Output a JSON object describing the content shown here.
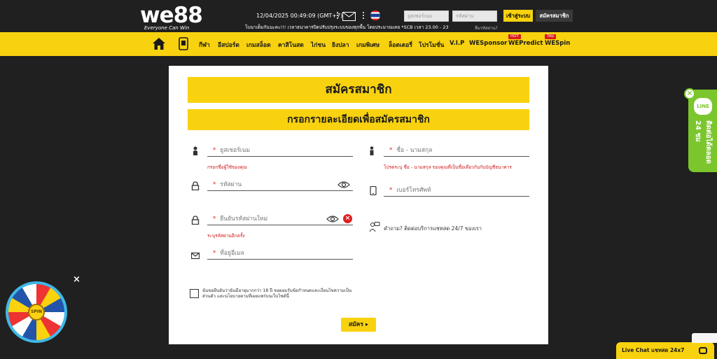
{
  "header": {
    "logo_text": "we88",
    "logo_tagline": "Everyone Can Win",
    "datetime": "12/04/2025 00:49:09",
    "timezone": "(GMT+7)",
    "username_placeholder": "ยูสเซอร์เนม",
    "password_placeholder": "รหัสผ่าน",
    "login_label": "เข้าสู่ระบบ",
    "register_label": "สมัครสมาชิก",
    "ticker_text": "โบนาเต็มกันนะคะ!!!    เวลาธนาคารปิดปรับปรุงระบบของทุกพื้น โดยประมาณเคย *SCB เวลา 23.00 - 23.3",
    "forgot_password": "ลืมรหัสผ่าน?"
  },
  "nav": {
    "items": [
      "กีฬา",
      "อีสปอร์ต",
      "เกมสล็อต",
      "คาสิโนสด",
      "ไก่ชน",
      "ยิงปลา",
      "เกมพิเศษ",
      "ล็อตเตอรี่",
      "โปรโมชั่น",
      "V.I.P",
      "WESponsor",
      "WEPredict",
      "WESpin"
    ],
    "badge_hot": "HOT",
    "badge_new": "ใหม่"
  },
  "form": {
    "title": "สมัครสมาชิก",
    "subtitle": "กรอกรายละเอียดเพื่อสมัครสมาชิก",
    "username_placeholder": "ยูสเซอร์เนม",
    "username_hint": "กรอกชื่อผู้ใช้ของคุณ",
    "fullname_placeholder": "ชื่อ - นามสกุล",
    "fullname_hint": "โปรดระบุ ชื่อ - นามสกุล ของคุณที่เป็นชื่อเดียวกันกับบัญชีธนาคาร",
    "password_placeholder": "รหัสผ่าน",
    "phone_placeholder": "เบอร์โทรศัพท์",
    "confirm_password_placeholder": "ยืนยันรหัสผ่านใหม่",
    "confirm_password_hint": "ระบุรหัสผ่านอีกครั้ง",
    "support_text": "คำถาม? ติดต่อบริการแชทสด 24/7 ของเรา",
    "email_placeholder": "ที่อยู่อีเมล",
    "consent_text": "ฉันขอยืนยันว่าฉันมีอายุมากกว่า 18 ปี ขอยอมรับข้อกำหนดและเงื่อนไขความเป็นส่วนตัว และนโยบายตามที่เผยแพร่บนเว็บไซต์นี้",
    "submit_label": "สมัคร",
    "required_mark": "*"
  },
  "widgets": {
    "line_label": "LINE",
    "line_text": "ติดต่อได้ตลอด 24 ชม",
    "wheel_label": "SPIN",
    "livechat_label": "Live Chat แชทสด 24x7"
  },
  "colors": {
    "brand_yellow": "#f8d20f",
    "background": "#202020",
    "error_red": "#d01a1a",
    "line_green": "#7bc62d"
  }
}
